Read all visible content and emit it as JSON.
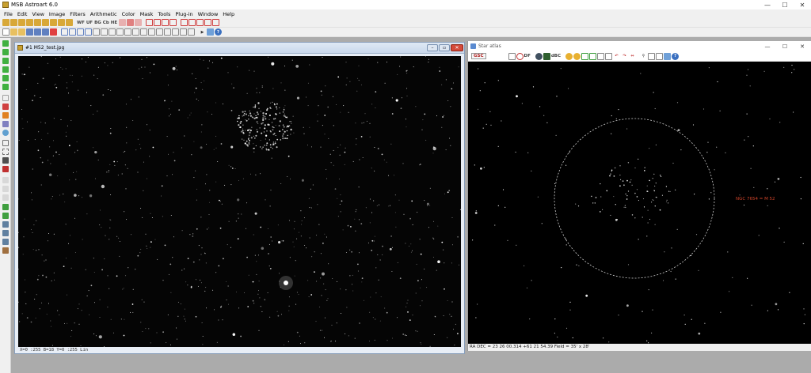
{
  "app": {
    "title": "MSB Astroart 6.0",
    "window_controls": [
      "—",
      "☐",
      "✕"
    ]
  },
  "menu": [
    "File",
    "Edit",
    "View",
    "Image",
    "Filters",
    "Arithmetic",
    "Color",
    "Mask",
    "Tools",
    "Plug-in",
    "Window",
    "Help"
  ],
  "toolbar": {
    "row1_text_buttons": [
      "WF",
      "UF",
      "BG",
      "Cb",
      "HE"
    ]
  },
  "image_window": {
    "title": "#1 M52_test.jpg",
    "controls": [
      "–",
      "▫",
      "✕"
    ],
    "status": "X=0 :255  B=18  Y=0 :255 Lin"
  },
  "star_atlas": {
    "title": "Star atlas",
    "controls": [
      "—",
      "☐",
      "✕"
    ],
    "catalog_button": "GSC",
    "tool_text": [
      "dBC",
      "DF"
    ],
    "object_label": "NGC 7654 = M 52",
    "status": "RA DEC = 23 26 00.314 +61 21 54.39  Field = 35' x 28'"
  },
  "colors": {
    "titlebar": "#ffffff",
    "menu_bg": "#f0f0f0",
    "workspace": "#ababab",
    "sky": "#000000",
    "object_label": "#d0442a",
    "circle": "#cccccc"
  }
}
